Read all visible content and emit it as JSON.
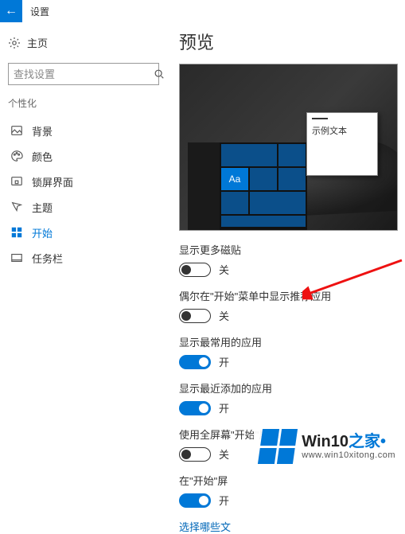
{
  "titlebar": {
    "back_icon": "←",
    "title": "设置"
  },
  "sidebar": {
    "home_label": "主页",
    "search_placeholder": "查找设置",
    "section": "个性化",
    "items": [
      {
        "icon": "image",
        "label": "背景"
      },
      {
        "icon": "palette",
        "label": "颜色"
      },
      {
        "icon": "lock",
        "label": "锁屏界面"
      },
      {
        "icon": "theme",
        "label": "主题"
      },
      {
        "icon": "start",
        "label": "开始",
        "active": true
      },
      {
        "icon": "taskbar",
        "label": "任务栏"
      }
    ]
  },
  "main": {
    "title": "预览",
    "sample_window_text": "示例文本",
    "aa_tile": "Aa",
    "settings": [
      {
        "label": "显示更多磁贴",
        "on": false,
        "state": "关"
      },
      {
        "label": "偶尔在\"开始\"菜单中显示推荐应用",
        "on": false,
        "state": "关"
      },
      {
        "label": "显示最常用的应用",
        "on": true,
        "state": "开"
      },
      {
        "label": "显示最近添加的应用",
        "on": true,
        "state": "开"
      },
      {
        "label": "使用全屏幕\"开始\"屏幕",
        "on": false,
        "state": "关"
      },
      {
        "label": "在\"开始\"屏",
        "on": true,
        "state": "开"
      }
    ],
    "link": "选择哪些文"
  },
  "watermark": {
    "main": "Win10",
    "suffix": "之家",
    "dot": "•",
    "url": "www.win10xitong.com"
  }
}
